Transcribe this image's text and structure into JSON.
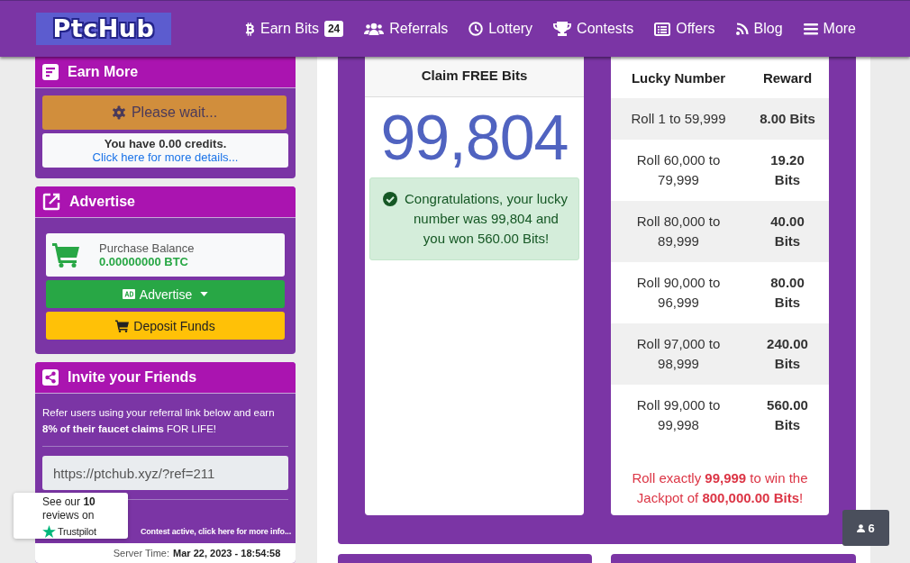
{
  "navbar": {
    "logo": "PtcHub",
    "items": [
      {
        "kind": "bitcoin",
        "label": "Earn Bits",
        "badge": "24"
      },
      {
        "kind": "users",
        "label": "Referrals"
      },
      {
        "kind": "clock",
        "label": "Lottery"
      },
      {
        "kind": "trophy",
        "label": "Contests"
      },
      {
        "kind": "list",
        "label": "Offers"
      },
      {
        "kind": "rss",
        "label": "Blog"
      },
      {
        "kind": "bars",
        "label": "More"
      }
    ]
  },
  "sidebar": {
    "earn_more": {
      "title": "Earn More",
      "wait_button": "Please wait...",
      "credits_text": "You have 0.00 credits.",
      "details_link": "Click here for more details..."
    },
    "advertise": {
      "title": "Advertise",
      "balance_label": "Purchase Balance",
      "balance": "0.00000000 BTC",
      "advertise_button": "Advertise",
      "deposit_button": "Deposit Funds"
    },
    "invite": {
      "title": "Invite your Friends",
      "text": "Refer users using your referral link below and earn **8% of their faucet claims** FOR LIFE!",
      "referral_link": "https://ptchub.xyz/?ref=211",
      "contest_link": "Contest active, click here for more info...",
      "server_time_label": "Server Time:",
      "server_time": "Mar 22, 2023 - 18:54:58"
    }
  },
  "claim": {
    "title": "Claim FREE Bits",
    "number": "99,804",
    "message": "Congratulations, your lucky number was 99,804 and you won 560.00 Bits!"
  },
  "rewards": {
    "columns": [
      "Lucky Number",
      "Reward"
    ],
    "rows": [
      {
        "range": "Roll 1 to 59,999",
        "reward": "8.00 Bits"
      },
      {
        "range": "Roll 60,000 to 79,999",
        "reward": "19.20 Bits"
      },
      {
        "range": "Roll 80,000 to 89,999",
        "reward": "40.00 Bits"
      },
      {
        "range": "Roll 90,000 to 96,999",
        "reward": "80.00 Bits"
      },
      {
        "range": "Roll 97,000 to 98,999",
        "reward": "240.00 Bits"
      },
      {
        "range": "Roll 99,000 to 99,998",
        "reward": "560.00 Bits"
      }
    ],
    "jackpot": "Roll exactly **99,999** to win the Jackpot of **800,000.00 Bits**!"
  },
  "trustpilot": {
    "text": "See our **10** reviews on",
    "brand": "Trustpilot"
  },
  "online_badge": {
    "count": "6"
  }
}
